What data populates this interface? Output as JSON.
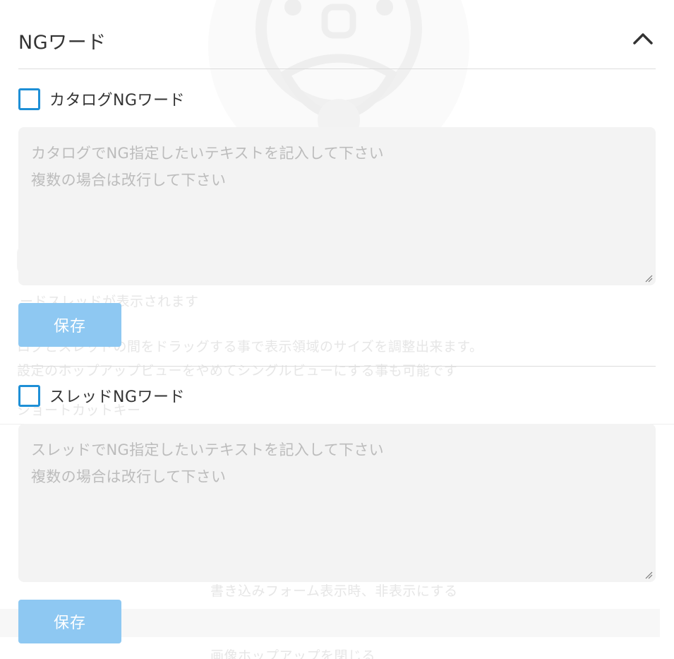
{
  "section": {
    "title": "NGワード"
  },
  "catalog": {
    "checkbox_label": "カタログNGワード",
    "placeholder": "カタログでNG指定したいテキストを記入して下さい\n複数の場合は改行して下さい",
    "save_label": "保存"
  },
  "thread": {
    "checkbox_label": "スレッドNGワード",
    "placeholder": "スレッドでNG指定したいテキストを記入して下さい\n複数の場合は改行して下さい",
    "save_label": "保存"
  },
  "background_ghost": {
    "line1": "ードスレッドが表示されます",
    "line2": "ログとスレッドの間をドラッグする事で表示領域のサイズを調整出来ます。",
    "line3": "設定のホップアップビューをやめてシングルビューにする事も可能です",
    "line4": "ショートカットキー",
    "line5": "書き込みフォーム表示時、非表示にする",
    "line6": "画像ホップアップを閉じる"
  },
  "colors": {
    "accent": "#1e8fd6",
    "save_button_bg": "#8ec8f2",
    "textarea_bg": "#f3f3f3",
    "placeholder": "#bcbcbc",
    "divider": "#dcdcdc"
  },
  "icons": {
    "collapse": "chevron-up-icon",
    "resize": "resize-grip-icon",
    "watermark": "mascot-watermark-icon"
  }
}
